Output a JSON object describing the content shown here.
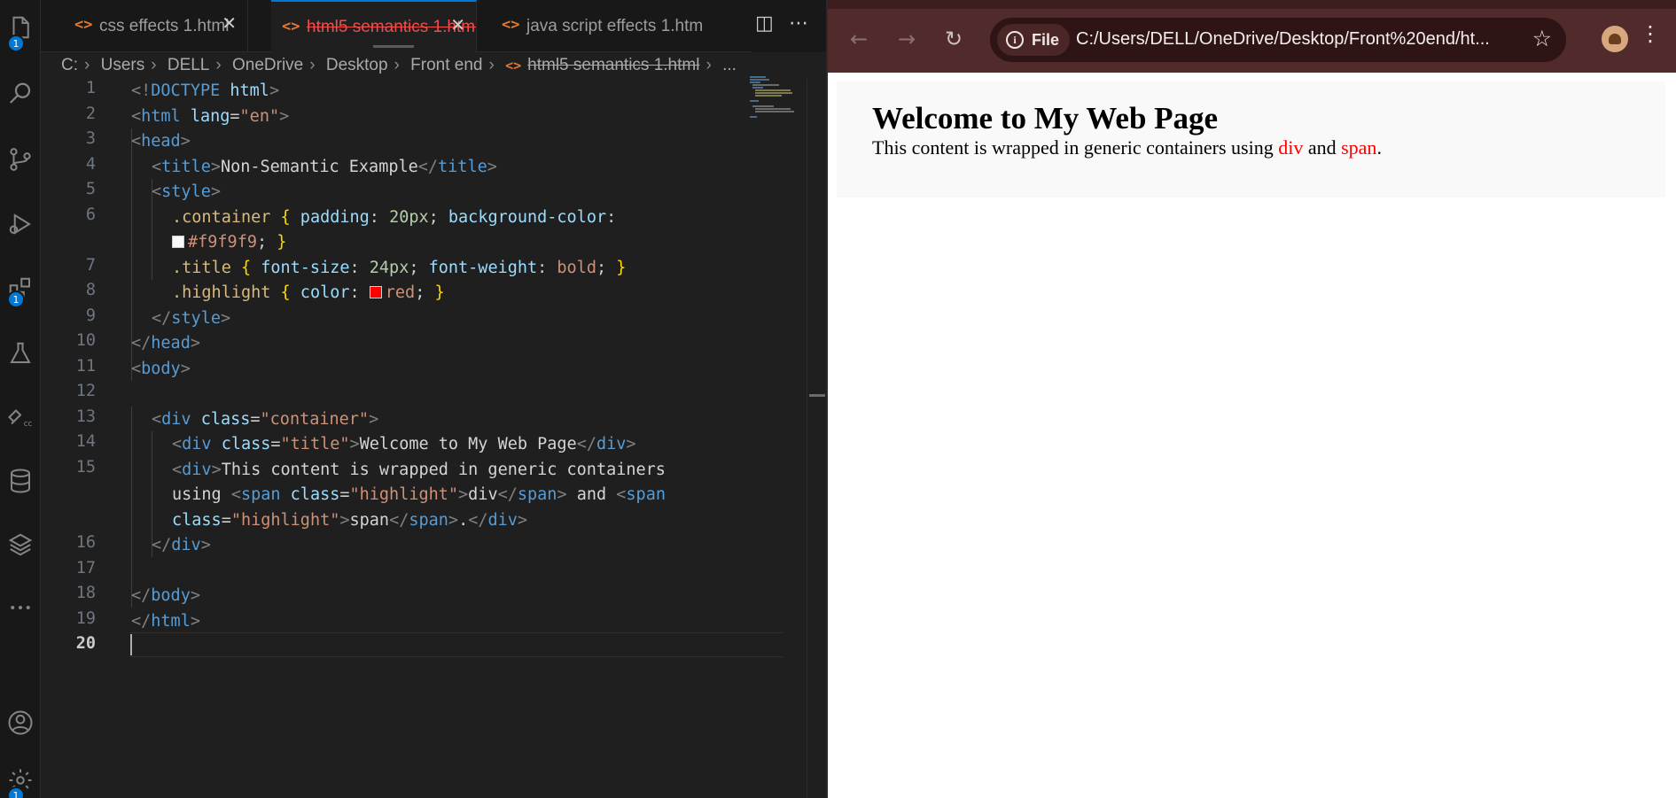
{
  "editor": {
    "tabs": [
      {
        "label": "css effects 1.html",
        "icon": "html-file-icon",
        "active": false
      },
      {
        "label": "html5 semantics 1.html",
        "icon": "html-file-icon",
        "active": true
      },
      {
        "label": "java script effects 1.htm",
        "icon": "html-file-icon",
        "active": false
      }
    ],
    "breadcrumb": [
      "C:",
      "Users",
      "DELL",
      "OneDrive",
      "Desktop",
      "Front end",
      "html5 semantics 1.html",
      "..."
    ],
    "line_numbers": [
      "1",
      "2",
      "3",
      "4",
      "5",
      "6",
      "",
      "7",
      "8",
      "9",
      "10",
      "11",
      "12",
      "13",
      "14",
      "15",
      "",
      "",
      "16",
      "17",
      "18",
      "19",
      "20"
    ],
    "current_line": "20",
    "activity_badges": {
      "explorer": "1",
      "extensions": "1",
      "settings": "1"
    },
    "colors": {
      "background": "#1f1f1f",
      "accent": "#0078d4",
      "modified_tab": "#f14c4c"
    }
  },
  "code": {
    "l1_a": "<!",
    "l1_b": "DOCTYPE",
    "l1_c": " html",
    "l1_d": ">",
    "l2_a": "<",
    "l2_b": "html",
    "l2_c": " lang",
    "l2_d": "=",
    "l2_e": "\"en\"",
    "l2_f": ">",
    "l3_a": "<",
    "l3_b": "head",
    "l3_c": ">",
    "l4_a": "<",
    "l4_b": "title",
    "l4_c": ">",
    "l4_d": "Non-Semantic Example",
    "l4_e": "</",
    "l4_f": "title",
    "l4_g": ">",
    "l5_a": "<",
    "l5_b": "style",
    "l5_c": ">",
    "l6_a": ".container",
    "l6_b": " {",
    "l6_c": " padding",
    "l6_d": ": ",
    "l6_e": "20px",
    "l6_f": ";",
    "l6_g": " background-color",
    "l6_h": ":",
    "l6w_b": "#f9f9f9",
    "l6w_c": ";",
    "l6w_d": " }",
    "l7_a": ".title",
    "l7_b": " {",
    "l7_c": " font-size",
    "l7_d": ": ",
    "l7_e": "24px",
    "l7_f": ";",
    "l7_g": " font-weight",
    "l7_h": ": ",
    "l7_i": "bold",
    "l7_j": ";",
    "l7_k": " }",
    "l8_a": ".highlight",
    "l8_b": " {",
    "l8_c": " color",
    "l8_d": ": ",
    "l8_e": "red",
    "l8_f": ";",
    "l8_g": " }",
    "l9_a": "</",
    "l9_b": "style",
    "l9_c": ">",
    "l10_a": "</",
    "l10_b": "head",
    "l10_c": ">",
    "l11_a": "<",
    "l11_b": "body",
    "l11_c": ">",
    "l13_a": "<",
    "l13_b": "div",
    "l13_c": " class",
    "l13_d": "=",
    "l13_e": "\"container\"",
    "l13_f": ">",
    "l14_a": "<",
    "l14_b": "div",
    "l14_c": " class",
    "l14_d": "=",
    "l14_e": "\"title\"",
    "l14_f": ">",
    "l14_g": "Welcome to My Web Page",
    "l14_h": "</",
    "l14_i": "div",
    "l14_j": ">",
    "l15_a": "<",
    "l15_b": "div",
    "l15_c": ">",
    "l15_d": "This content is wrapped in generic containers",
    "l15w1_a": "using ",
    "l15w1_b": "<",
    "l15w1_c": "span",
    "l15w1_d": " class",
    "l15w1_e": "=",
    "l15w1_f": "\"highlight\"",
    "l15w1_g": ">",
    "l15w1_h": "div",
    "l15w1_i": "</",
    "l15w1_j": "span",
    "l15w1_k": ">",
    "l15w1_l": " and ",
    "l15w1_m": "<",
    "l15w1_n": "span",
    "l15w2_a": "class",
    "l15w2_b": "=",
    "l15w2_c": "\"highlight\"",
    "l15w2_d": ">",
    "l15w2_e": "span",
    "l15w2_f": "</",
    "l15w2_g": "span",
    "l15w2_h": ">",
    "l15w2_i": ".",
    "l15w2_j": "</",
    "l15w2_k": "div",
    "l15w2_l": ">",
    "l16_a": "</",
    "l16_b": "div",
    "l16_c": ">",
    "l18_a": "</",
    "l18_b": "body",
    "l18_c": ">",
    "l19_a": "</",
    "l19_b": "html",
    "l19_c": ">"
  },
  "browser": {
    "chip_label": "File",
    "url": "C:/Users/DELL/OneDrive/Desktop/Front%20end/ht...",
    "theme_color": "#512b2b"
  },
  "page": {
    "title": "Welcome to My Web Page",
    "text_before": "This content is wrapped in generic containers using ",
    "hl1": "div",
    "text_mid": " and ",
    "hl2": "span",
    "text_end": ".",
    "background": "#f9f9f9",
    "highlight_color": "red"
  }
}
